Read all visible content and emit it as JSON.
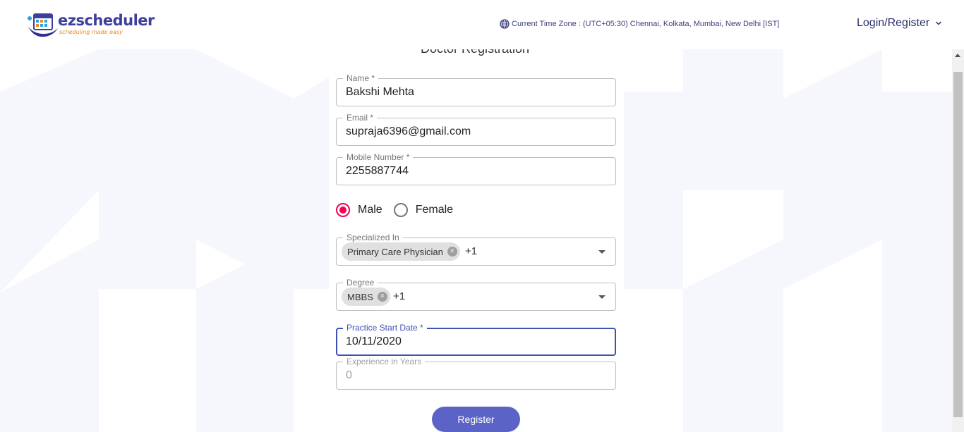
{
  "header": {
    "logo_text": "ezscheduler",
    "logo_tagline": "scheduling made easy",
    "timezone": "Current Time Zone : (UTC+05:30) Chennai, Kolkata, Mumbai, New Delhi [IST]",
    "login_label": "Login/Register"
  },
  "form": {
    "title": "Doctor Registration",
    "name": {
      "label": "Name *",
      "value": "Bakshi Mehta"
    },
    "email": {
      "label": "Email *",
      "value": "supraja6396@gmail.com"
    },
    "mobile": {
      "label": "Mobile Number *",
      "value": "2255887744"
    },
    "gender": {
      "options": [
        "Male",
        "Female"
      ],
      "selected": "Male"
    },
    "specialized": {
      "label": "Specialized In",
      "chip": "Primary Care Physician",
      "more": "+1"
    },
    "degree": {
      "label": "Degree",
      "chip": "MBBS",
      "more": "+1"
    },
    "practice_start": {
      "label": "Practice Start Date *",
      "value": "10/11/2020"
    },
    "experience": {
      "label": "Experience in Years",
      "value": "0"
    },
    "submit_label": "Register"
  },
  "colors": {
    "accent": "#5c63c6",
    "brand": "#3d3f9c",
    "radio_checked": "#f50057",
    "focus": "#3f51b5"
  },
  "icons": {
    "timezone": "globe-icon",
    "login": "chevron-down-icon",
    "chip_remove": "cancel-circle-icon",
    "select": "arrow-drop-down-icon"
  }
}
